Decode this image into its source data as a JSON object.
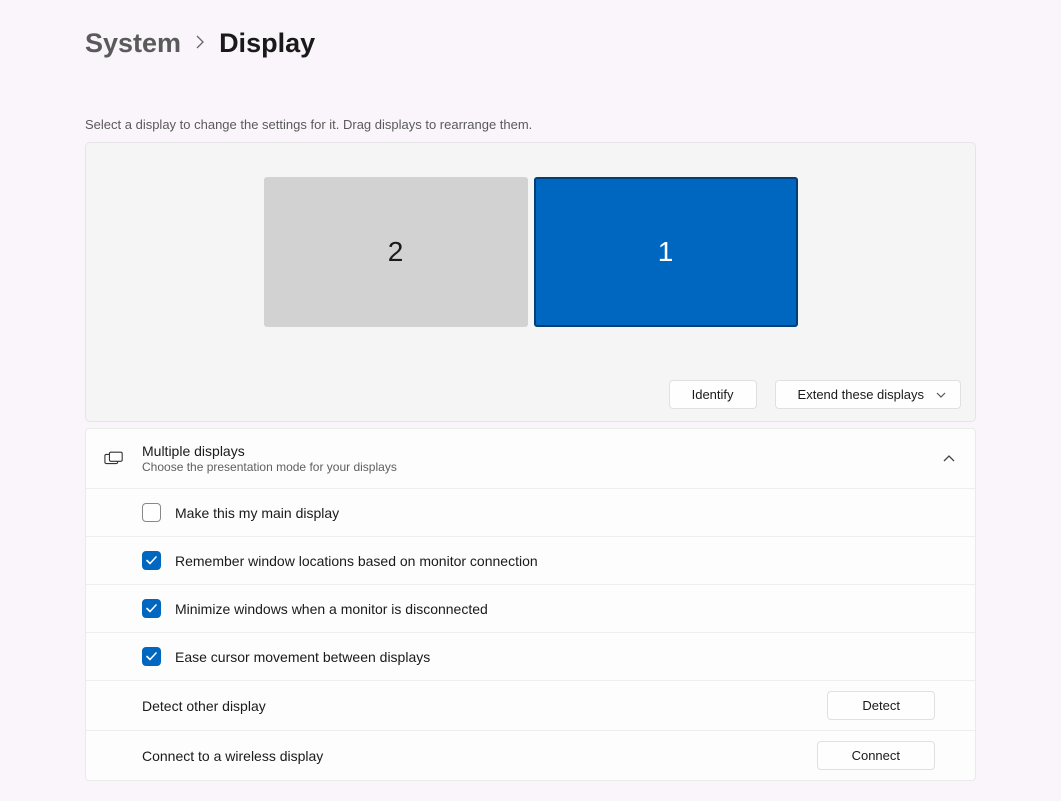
{
  "breadcrumb": {
    "parent": "System",
    "current": "Display"
  },
  "instruction": "Select a display to change the settings for it. Drag displays to rearrange them.",
  "monitors": {
    "left": "2",
    "right": "1"
  },
  "panel_buttons": {
    "identify": "Identify",
    "extend": "Extend these displays"
  },
  "multi": {
    "title": "Multiple displays",
    "subtitle": "Choose the presentation mode for your displays",
    "options": {
      "main": "Make this my main display",
      "remember": "Remember window locations based on monitor connection",
      "minimize": "Minimize windows when a monitor is disconnected",
      "ease": "Ease cursor movement between displays"
    },
    "actions": {
      "detect_label": "Detect other display",
      "detect_btn": "Detect",
      "connect_label": "Connect to a wireless display",
      "connect_btn": "Connect"
    }
  }
}
